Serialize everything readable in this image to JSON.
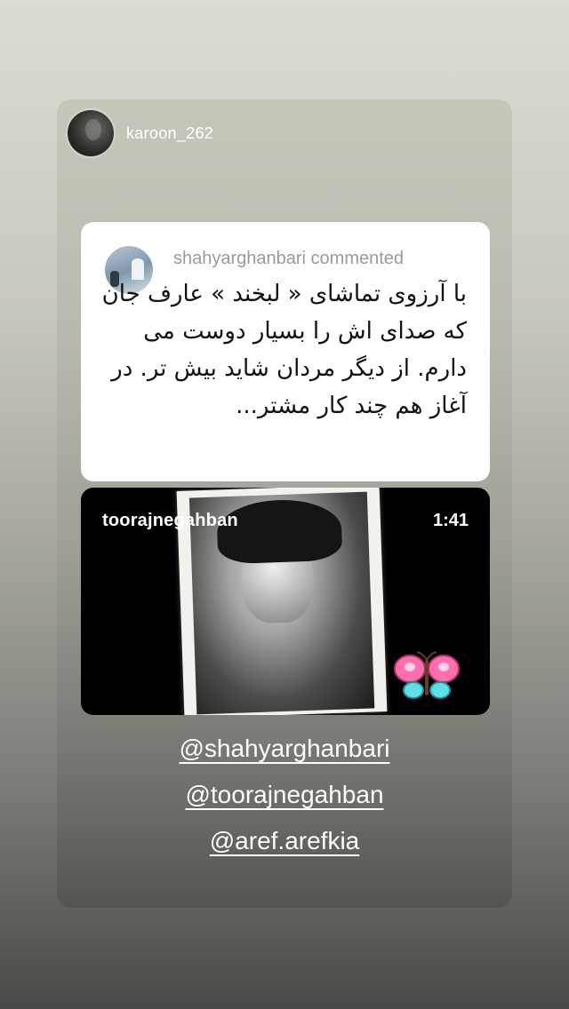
{
  "story": {
    "username": "karoon_262"
  },
  "comment": {
    "author_line": "shahyarghanbari commented",
    "text": "با آرزوی تماشای « لبخند » عارف جان که صدای اش را بسیار دوست می دارم. از دیگر مردان شاید بیش تر. در آغاز هم چند کار مشتر..."
  },
  "video": {
    "username": "toorajnegahban",
    "duration": "1:41"
  },
  "mentions": [
    "@shahyarghanbari",
    "@toorajnegahban",
    "@aref.arefkia"
  ],
  "colors": {
    "comment_bg": "#ffffff",
    "video_bg": "#000000",
    "text_light": "#ffffff",
    "commenter_gray": "#9a9a9a"
  },
  "icons": {
    "sticker": "butterfly-sticker-icon"
  }
}
